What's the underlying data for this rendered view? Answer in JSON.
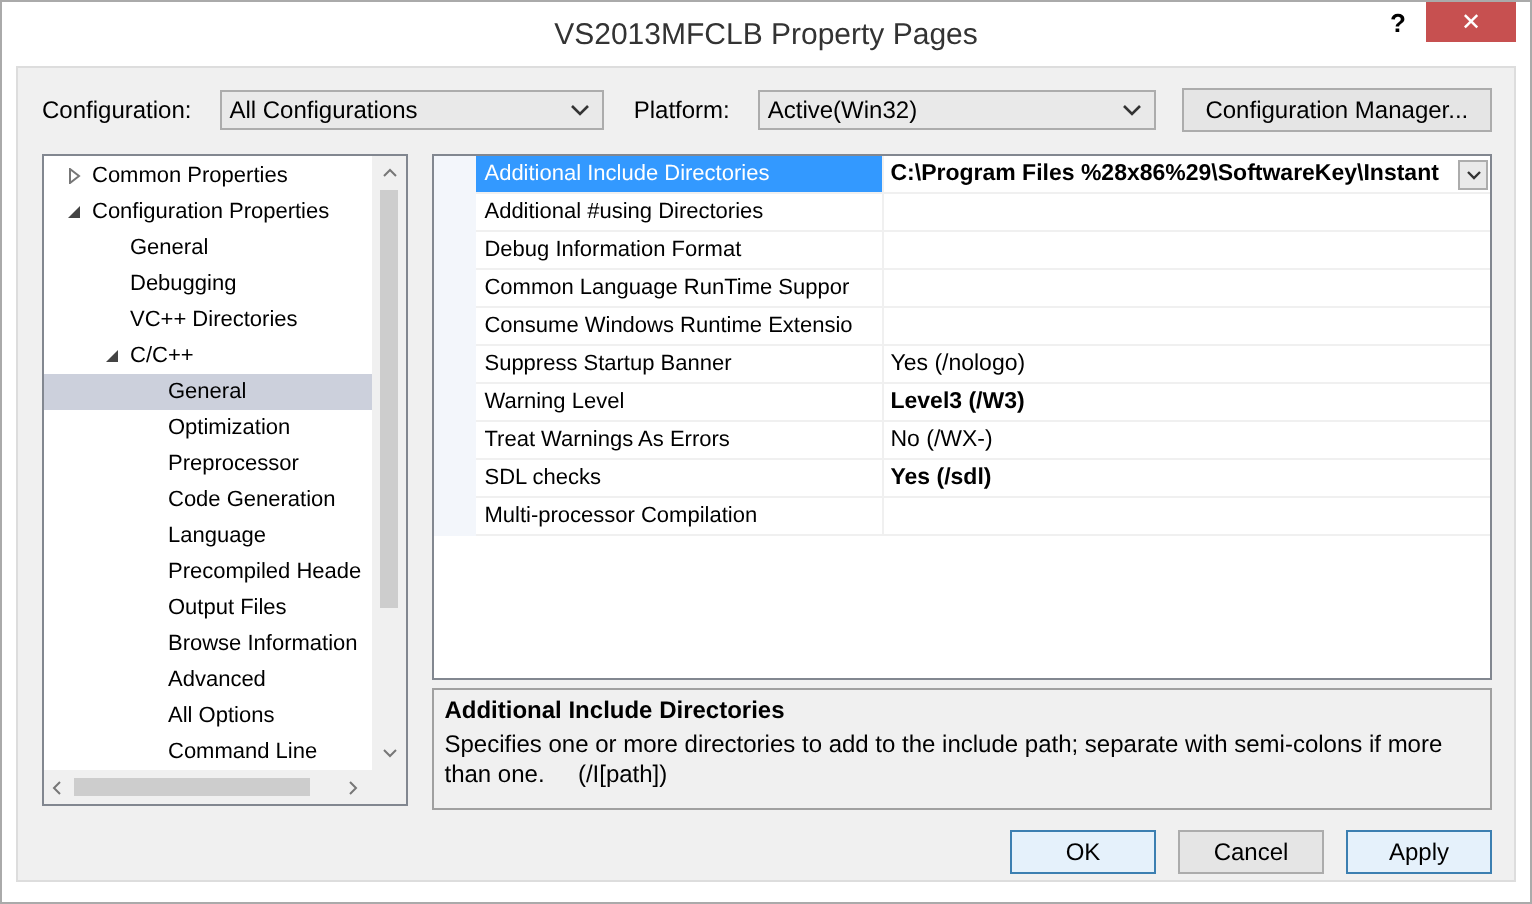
{
  "window": {
    "title": "VS2013MFCLB Property Pages",
    "help": "?",
    "close": "✕"
  },
  "configuration": {
    "label": "Configuration:",
    "value": "All Configurations"
  },
  "platform": {
    "label": "Platform:",
    "value": "Active(Win32)"
  },
  "configuration_manager": "Configuration Manager...",
  "tree": [
    {
      "label": "Common Properties",
      "expanded": false,
      "selected": false
    },
    {
      "label": "Configuration Properties",
      "expanded": true,
      "selected": false,
      "children": [
        {
          "label": "General",
          "selected": false
        },
        {
          "label": "Debugging",
          "selected": false
        },
        {
          "label": "VC++ Directories",
          "selected": false
        },
        {
          "label": "C/C++",
          "expanded": true,
          "selected": false,
          "children": [
            {
              "label": "General",
              "selected": true
            },
            {
              "label": "Optimization",
              "selected": false
            },
            {
              "label": "Preprocessor",
              "selected": false
            },
            {
              "label": "Code Generation",
              "selected": false
            },
            {
              "label": "Language",
              "selected": false
            },
            {
              "label": "Precompiled Heade",
              "selected": false
            },
            {
              "label": "Output Files",
              "selected": false
            },
            {
              "label": "Browse Information",
              "selected": false
            },
            {
              "label": "Advanced",
              "selected": false
            },
            {
              "label": "All Options",
              "selected": false
            },
            {
              "label": "Command Line",
              "selected": false
            }
          ]
        }
      ]
    }
  ],
  "properties": [
    {
      "name": "Additional Include Directories",
      "value": "C:\\Program Files %28x86%29\\SoftwareKey\\Instant",
      "bold": true,
      "selected": true
    },
    {
      "name": "Additional #using Directories",
      "bold": false,
      "selected": false
    },
    {
      "name": "Debug Information Format",
      "bold": false,
      "selected": false
    },
    {
      "name": "Common Language RunTime Suppor",
      "bold": false,
      "selected": false
    },
    {
      "name": "Consume Windows Runtime Extensio",
      "bold": false,
      "selected": false
    },
    {
      "name": "Suppress Startup Banner",
      "value": "Yes (/nologo)",
      "bold": false,
      "selected": false
    },
    {
      "name": "Warning Level",
      "value": "Level3 (/W3)",
      "bold": true,
      "selected": false
    },
    {
      "name": "Treat Warnings As Errors",
      "value": "No (/WX-)",
      "bold": false,
      "selected": false
    },
    {
      "name": "SDL checks",
      "value": "Yes (/sdl)",
      "bold": true,
      "selected": false
    },
    {
      "name": "Multi-processor Compilation",
      "bold": false,
      "selected": false
    }
  ],
  "description": {
    "title": "Additional Include Directories",
    "text": "Specifies one or more directories to add to the include path; separate with semi-colons if more than one.     (/I[path])"
  },
  "buttons": [
    {
      "label": "OK",
      "kind": "default"
    },
    {
      "label": "Cancel",
      "kind": "normal"
    },
    {
      "label": "Apply",
      "kind": "default"
    }
  ]
}
